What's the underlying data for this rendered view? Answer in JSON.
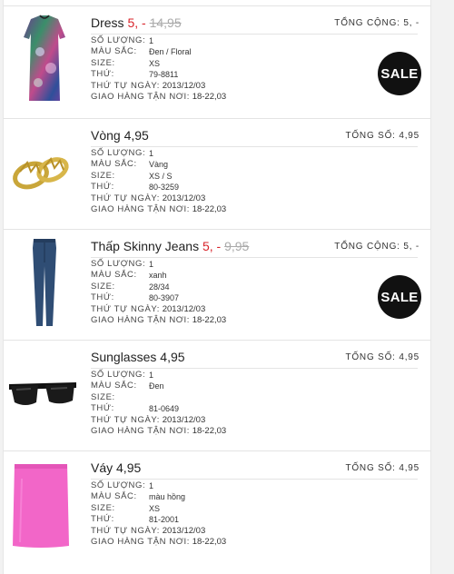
{
  "items": [
    {
      "name": "Dress",
      "price": "",
      "sale_price": "5, -",
      "old_price": "14,95",
      "total_label": "TỔNG CỘNG:",
      "total_value": "5, -",
      "badge": "SALE",
      "qty_label": "SỐ LƯỢNG:",
      "qty": "1",
      "color_label": "MÀU SẮC:",
      "color": "Đen / Floral",
      "size_label": "SIZE:",
      "size": "XS",
      "art_label": "THỨ:",
      "art": "79-8811",
      "order_label": "THỨ TỰ NGÀY:",
      "order_date": "2013/12/03",
      "delivery_label": "GIAO HÀNG TẬN NƠI:",
      "delivery": "18-22,03"
    },
    {
      "name": "Vòng",
      "price": "4,95",
      "sale_price": "",
      "old_price": "",
      "total_label": "TỐNG SỐ:",
      "total_value": "4,95",
      "badge": "",
      "qty_label": "SỐ LƯỢNG:",
      "qty": "1",
      "color_label": "MÀU SẮC:",
      "color": "Vàng",
      "size_label": "SIZE:",
      "size": "XS / S",
      "art_label": "THỨ:",
      "art": "80-3259",
      "order_label": "THỨ TỰ NGÀY:",
      "order_date": "2013/12/03",
      "delivery_label": "GIAO HÀNG TẬN NƠI:",
      "delivery": "18-22,03"
    },
    {
      "name": "Thấp Skinny Jeans",
      "price": "",
      "sale_price": "5, -",
      "old_price": "9,95",
      "total_label": "TỔNG CỘNG:",
      "total_value": "5, -",
      "badge": "SALE",
      "qty_label": "SỐ LƯỢNG:",
      "qty": "1",
      "color_label": "MÀU SẮC:",
      "color": "xanh",
      "size_label": "SIZE:",
      "size": "28/34",
      "art_label": "THỨ:",
      "art": "80-3907",
      "order_label": "THỨ TỰ NGÀY:",
      "order_date": "2013/12/03",
      "delivery_label": "GIAO HÀNG TẬN NƠI:",
      "delivery": "18-22,03"
    },
    {
      "name": "Sunglasses",
      "price": "4,95",
      "sale_price": "",
      "old_price": "",
      "total_label": "TỐNG SỐ:",
      "total_value": "4,95",
      "badge": "",
      "qty_label": "SỐ LƯỢNG:",
      "qty": "1",
      "color_label": "MÀU SẮC:",
      "color": "Đen",
      "size_label": "SIZE:",
      "size": "",
      "art_label": "THỨ:",
      "art": "81-0649",
      "order_label": "THỨ TỰ NGÀY:",
      "order_date": "2013/12/03",
      "delivery_label": "GIAO HÀNG TẬN NƠI:",
      "delivery": "18-22,03"
    },
    {
      "name": "Váy",
      "price": "4,95",
      "sale_price": "",
      "old_price": "",
      "total_label": "TỐNG SỐ:",
      "total_value": "4,95",
      "badge": "",
      "qty_label": "SỐ LƯỢNG:",
      "qty": "1",
      "color_label": "MÀU SẮC:",
      "color": "màu hồng",
      "size_label": "SIZE:",
      "size": "XS",
      "art_label": "THỨ:",
      "art": "81-2001",
      "order_label": "THỨ TỰ NGÀY:",
      "order_date": "2013/12/03",
      "delivery_label": "GIAO HÀNG TẬN NƠI:",
      "delivery": "18-22,03"
    }
  ],
  "thumbnails": [
    "dress-image",
    "bracelet-image",
    "jeans-image",
    "sunglasses-image",
    "skirt-image"
  ],
  "colors": {
    "sale": "#d8232a",
    "old_price": "#aaaaaa",
    "badge": "#111111",
    "skirt": "#f266c8",
    "jeans": "#2f4d74"
  }
}
